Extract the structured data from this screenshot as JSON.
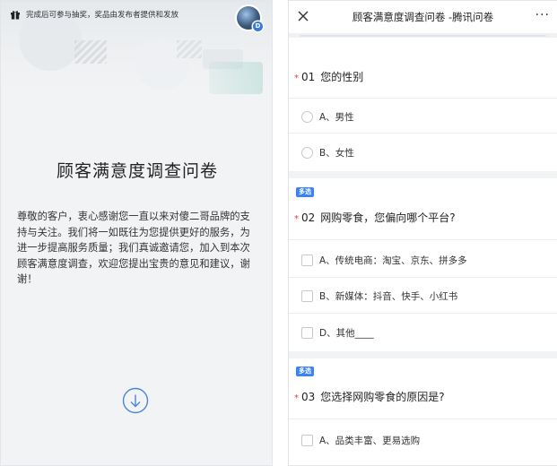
{
  "left": {
    "notice": "完成后可参与抽奖，奖品由发布者提供和发放",
    "avatar_badge": "D",
    "title": "顾客满意度调查问卷",
    "description": "尊敬的客户，衷心感谢您一直以来对傻二哥品牌的支持与关注。我们将一如既往为您提供更好的服务，为进一步提高服务质量；我们真诚邀请您，加入到本次顾客满意度调查，欢迎您提出宝贵的意见和建议，谢谢！"
  },
  "right": {
    "topbar": {
      "title": "顾客满意度调查问卷 -腾讯问卷",
      "more": "···"
    },
    "questions": [
      {
        "required": "*",
        "number": "01",
        "text": "您的性别",
        "badge": "",
        "options": [
          "A、男性",
          "B、女性"
        ]
      },
      {
        "required": "*",
        "number": "02",
        "text": "网购零食，您偏向哪个平台?",
        "badge": "多选",
        "options": [
          "A、传统电商：淘宝、京东、拼多多",
          "B、新媒体：抖音、快手、小红书",
          "D、其他____"
        ]
      },
      {
        "required": "*",
        "number": "03",
        "text": "您选择网购零食的原因是?",
        "badge": "多选",
        "options": [
          "A、品类丰富、更易选购"
        ]
      }
    ]
  },
  "colors": {
    "required_star": "#e54545",
    "badge_blue": "#3b82f6",
    "down_arrow": "#4a86d8"
  }
}
